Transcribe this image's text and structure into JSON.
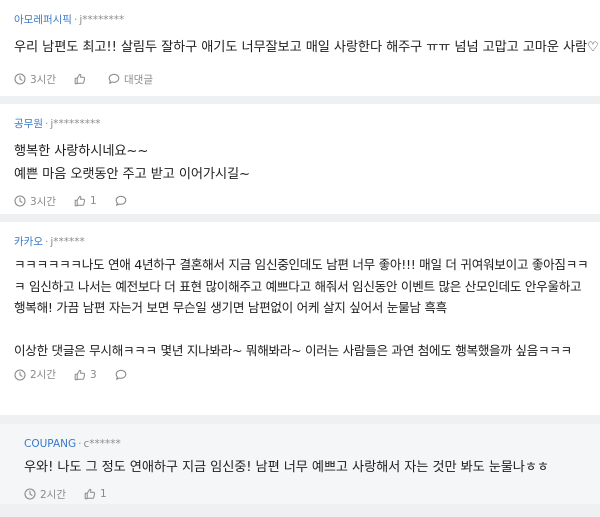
{
  "comments": [
    {
      "source": "아모레퍼시픽",
      "user": "j********",
      "text": "우리 남편도 최고!! 살림두 잘하구 애기도 너무잘보고 매일 사랑한다 해주구 ㅠㅠ 넘넘 고맙고 고마운 사람♡",
      "time": "3시간",
      "reply_label": "대댓글"
    },
    {
      "source": "공무원",
      "user": "j*********",
      "text": "행복한 사랑하시네요~~\n예쁜 마음 오랫동안 주고 받고 이어가시길~",
      "time": "3시간",
      "likes": "1"
    },
    {
      "source": "카카오",
      "user": "j******",
      "text": "ㅋㅋㅋㅋㅋㅋ나도 연애 4년하구 결혼해서 지금 임신중인데도 남편 너무 좋아!!! 매일 더 귀여워보이고 좋아짐ㅋㅋㅋ 임신하고 나서는 예전보다 더 표현 많이해주고 예쁘다고 해줘서 임신동안 이벤트 많은 산모인데도 안우울하고 행복해! 가끔 남편 자는거 보면 무슨일 생기면 남편없이 어케 살지 싶어서 눈물남 흑흑\n\n이상한 댓글은 무시해ㅋㅋㅋ 몇년 지나봐라~ 뭐해봐라~ 이러는 사람들은 과연 첨에도 행복했을까 싶음ㅋㅋㅋ",
      "time": "2시간",
      "likes": "3"
    },
    {
      "source": "COUPANG",
      "user": "c******",
      "text": "우와! 나도 그 정도 연애하구 지금 임신중! 남편 너무 예쁘고 사랑해서 자는 것만 봐도 눈물나ㅎㅎ",
      "time": "2시간",
      "likes": "1"
    }
  ],
  "icons": {
    "clock": "clock-icon",
    "like": "thumbs-up-icon",
    "reply": "comment-bubble-icon"
  }
}
